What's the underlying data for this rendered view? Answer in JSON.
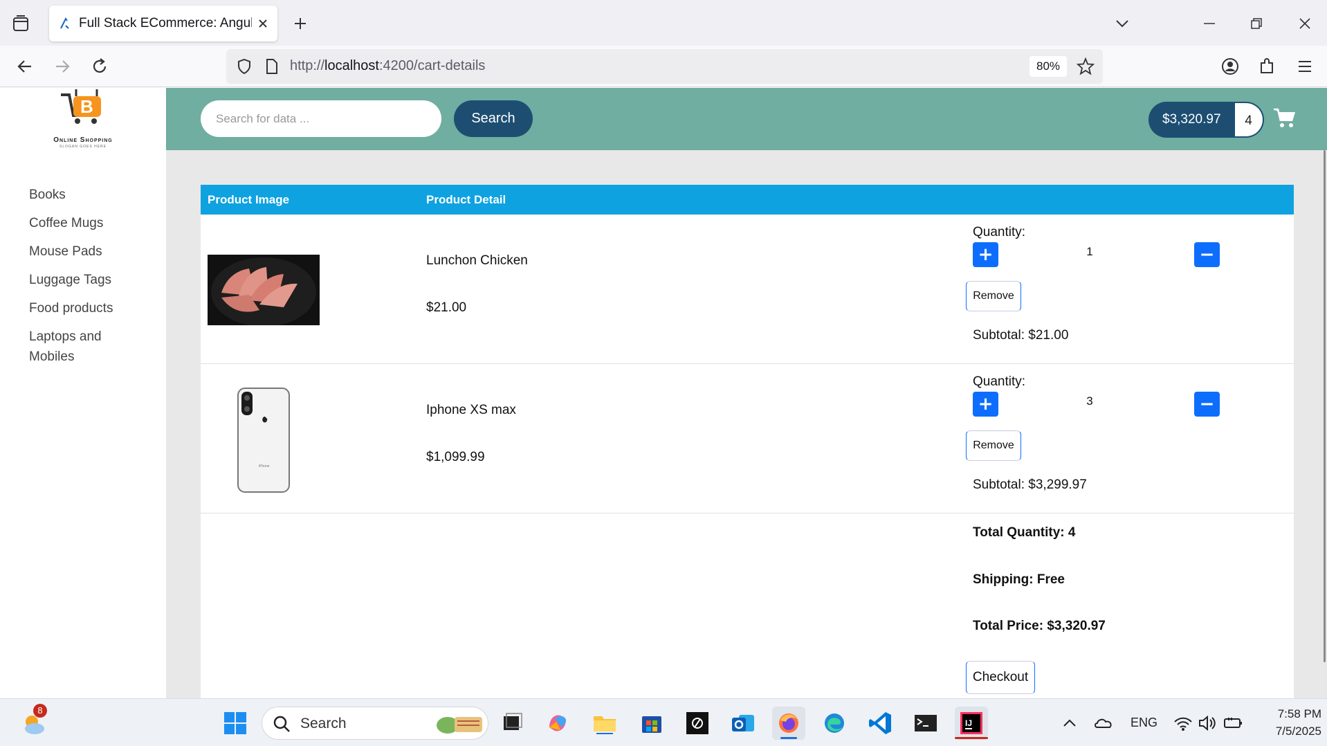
{
  "browser": {
    "tab_title": "Full Stack ECommerce: Angular",
    "url_prefix": "http://",
    "url_host": "localhost",
    "url_path": ":4200/cart-details",
    "zoom": "80%"
  },
  "sidebar": {
    "logo_text": "Online Shopping",
    "logo_subtext": "SLOGAN GOES HERE",
    "items": [
      {
        "label": "Books"
      },
      {
        "label": "Coffee Mugs"
      },
      {
        "label": "Mouse Pads"
      },
      {
        "label": "Luggage Tags"
      },
      {
        "label": "Food products"
      },
      {
        "label": "Laptops and Mobiles"
      }
    ]
  },
  "header": {
    "search_placeholder": "Search for data ...",
    "search_button": "Search",
    "cart_total": "$3,320.97",
    "cart_quantity": "4"
  },
  "cart": {
    "col_image": "Product Image",
    "col_detail": "Product Detail",
    "items": [
      {
        "name": "Lunchon Chicken",
        "price": "$21.00",
        "quantity_label": "Quantity:",
        "quantity": "1",
        "remove_label": "Remove",
        "subtotal": "Subtotal: $21.00"
      },
      {
        "name": "Iphone XS max",
        "price": "$1,099.99",
        "quantity_label": "Quantity:",
        "quantity": "3",
        "remove_label": "Remove",
        "subtotal": "Subtotal: $3,299.97"
      }
    ],
    "total_quantity": "Total Quantity: 4",
    "shipping": "Shipping: Free",
    "total_price": "Total Price: $3,320.97",
    "checkout_label": "Checkout"
  },
  "taskbar": {
    "weather_badge": "8",
    "search_label": "Search",
    "lang": "ENG",
    "time": "7:58 PM",
    "date": "7/5/2025"
  },
  "colors": {
    "header": "#6faea0",
    "table_header": "#0ea2e0",
    "primary_button": "#0d6efd",
    "navy": "#1d4e72"
  }
}
